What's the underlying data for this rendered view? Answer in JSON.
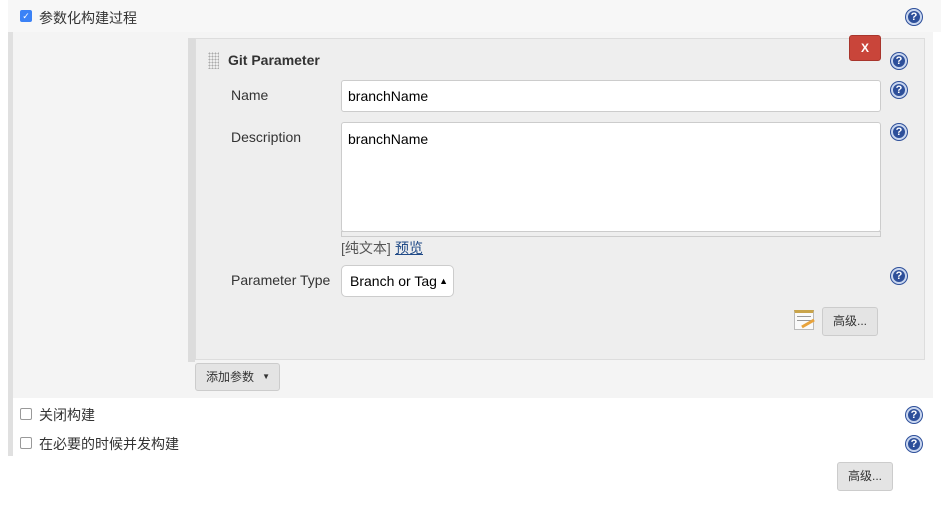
{
  "sections": {
    "parameterized": {
      "label": "参数化构建过程",
      "checked": true
    },
    "disable_build": {
      "label": "关闭构建",
      "checked": false
    },
    "concurrent_build": {
      "label": "在必要的时候并发构建",
      "checked": false
    }
  },
  "git_parameter": {
    "title": "Git Parameter",
    "delete_label": "X",
    "name_label": "Name",
    "name_value": "branchName",
    "description_label": "Description",
    "description_value": "branchName",
    "plain_text": "[纯文本]",
    "preview": "预览",
    "type_label": "Parameter Type",
    "type_value": "Branch or Tag",
    "advanced_label": "高级..."
  },
  "add_parameter_label": "添加参数",
  "advanced_label": "高级..."
}
